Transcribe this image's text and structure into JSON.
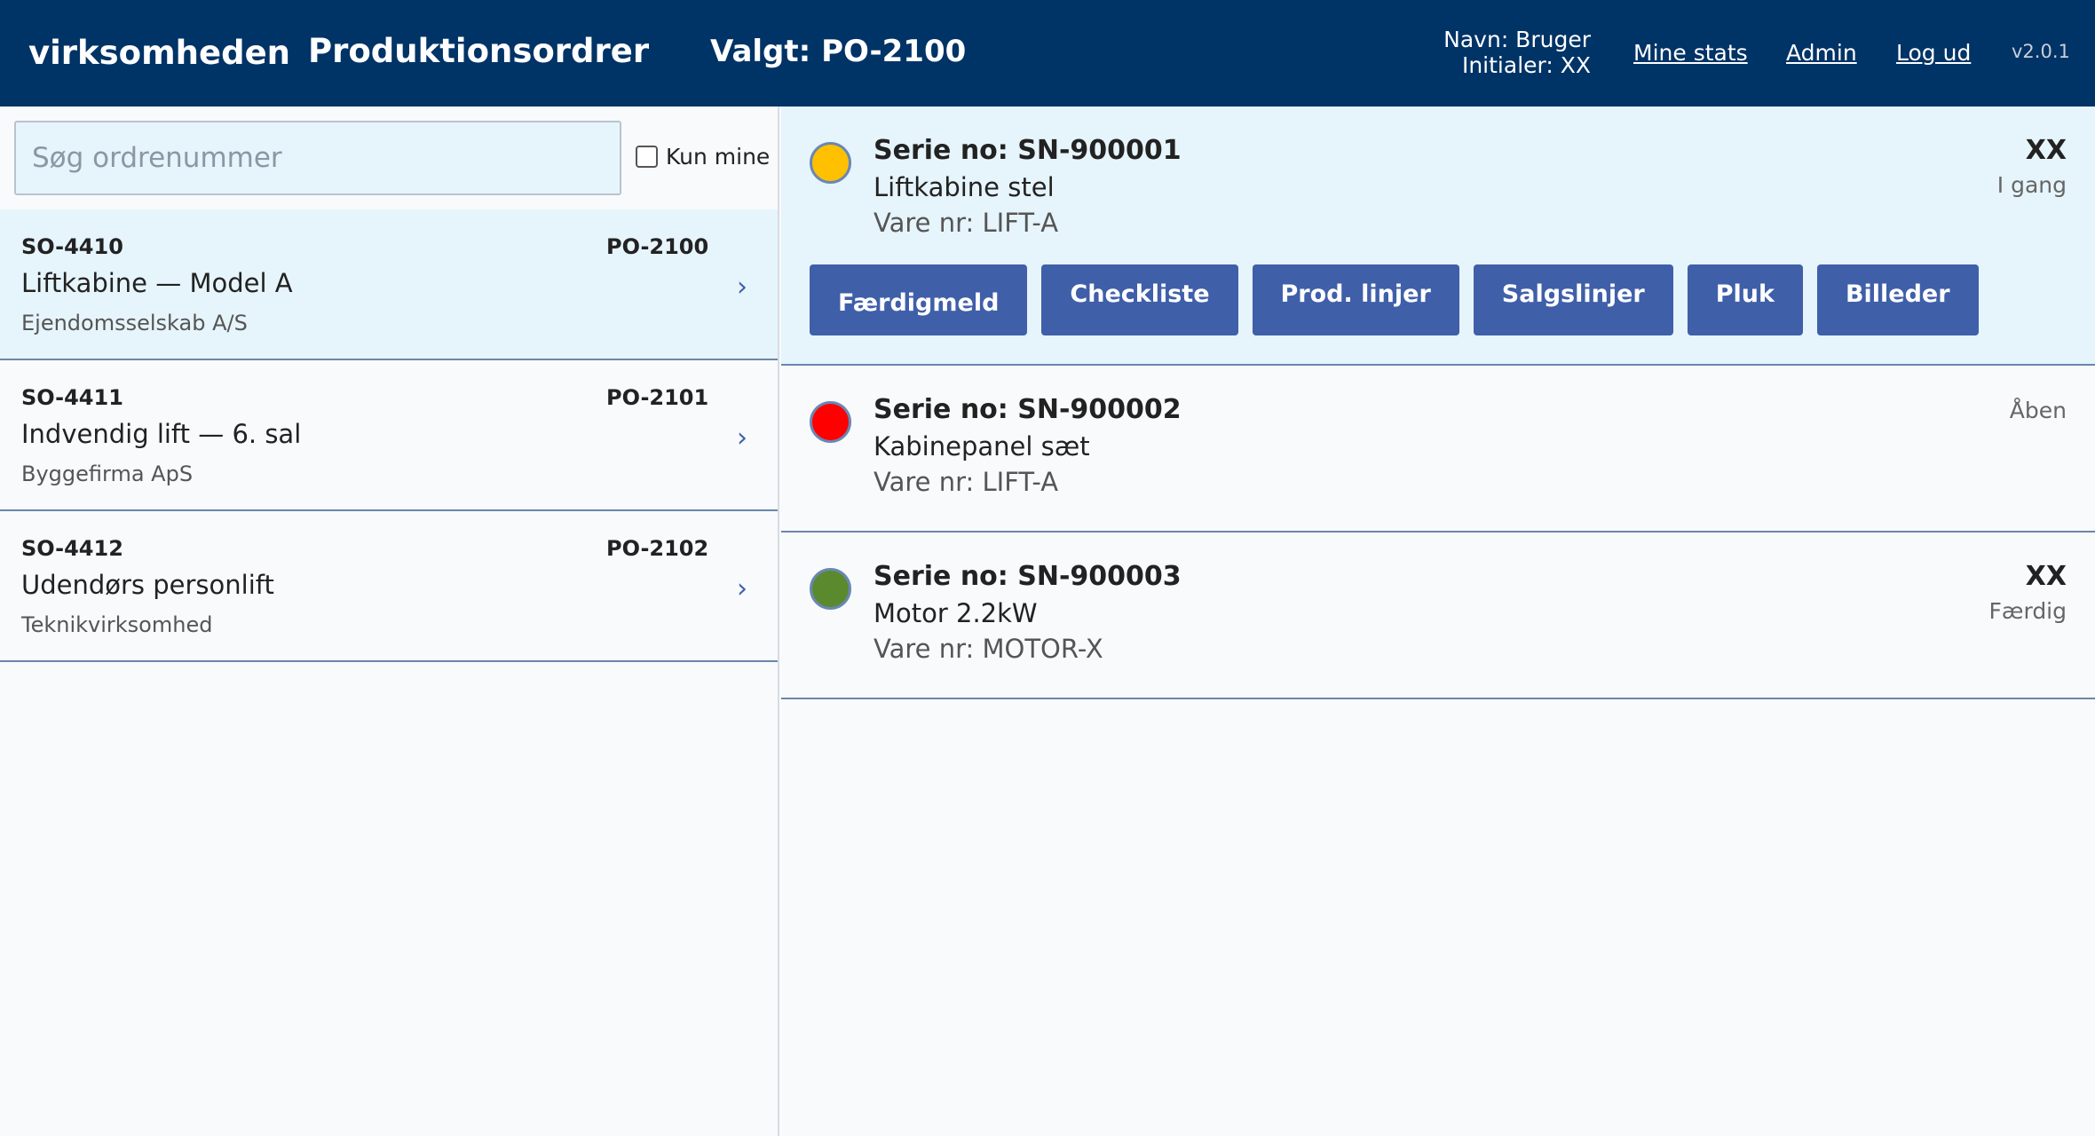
{
  "header": {
    "brand": "virksomheden",
    "title": "Produktionsordrer",
    "selected": "Valgt: PO-2100",
    "user_name": "Navn: Bruger",
    "user_initials": "Initialer: XX",
    "links": {
      "stats": "Mine stats",
      "admin": "Admin",
      "logout": "Log ud"
    },
    "version": "v2.0.1"
  },
  "search": {
    "placeholder": "Søg ordrenummer",
    "value": ""
  },
  "filter": {
    "only_mine_label": "Kun mine",
    "only_mine_checked": false
  },
  "orders": [
    {
      "so": "SO-4410",
      "po": "PO-2100",
      "title": "Liftkabine — Model A",
      "customer": "Ejendomsselskab A/S",
      "active": true
    },
    {
      "so": "SO-4411",
      "po": "PO-2101",
      "title": "Indvendig lift — 6. sal",
      "customer": "Byggefirma ApS",
      "active": false
    },
    {
      "so": "SO-4412",
      "po": "PO-2102",
      "title": "Udendørs personlift",
      "customer": "Teknikvirksomhed",
      "active": false
    }
  ],
  "serials": [
    {
      "serial": "Serie no: SN-900001",
      "name": "Liftkabine stel",
      "item": "Vare nr: LIFT-A",
      "initials": "XX",
      "status": "I gang",
      "status_color": "#ffc000",
      "active": true
    },
    {
      "serial": "Serie no: SN-900002",
      "name": "Kabinepanel sæt",
      "item": "Vare nr: LIFT-A",
      "initials": "",
      "status": "Åben",
      "status_color": "#ff0000",
      "active": false
    },
    {
      "serial": "Serie no: SN-900003",
      "name": "Motor 2.2kW",
      "item": "Vare nr: MOTOR-X",
      "initials": "XX",
      "status": "Færdig",
      "status_color": "#5b8a2e",
      "active": false
    }
  ],
  "actions": {
    "complete": "Færdigmeld",
    "checklist": "Checkliste",
    "prod_lines": "Prod. linjer",
    "sales_lines": "Salgslinjer",
    "pick": "Pluk",
    "images": "Billeder"
  },
  "colors": {
    "header_bg": "#003366",
    "accent": "#3f5fa9",
    "selected_bg": "#e6f4fb"
  }
}
